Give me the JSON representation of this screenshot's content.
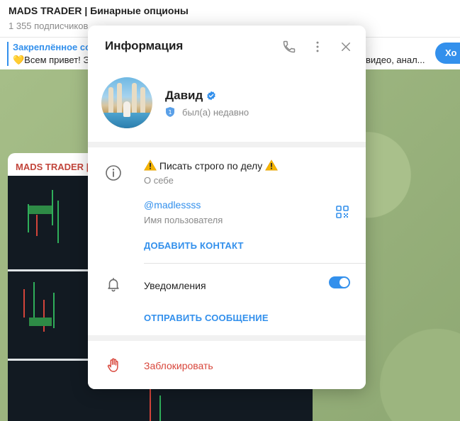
{
  "background": {
    "channel_title": "MADS TRADER | Бинарные опционы",
    "subscribers": "1 355 подписчиков",
    "pinned_title": "Закреплённое со",
    "pinned_text": "💛Всем привет! Э",
    "pinned_text_right": "видео, анал...",
    "pinned_button": "Хо",
    "message_author": "MADS TRADER |"
  },
  "modal": {
    "title": "Информация",
    "icons": {
      "call": "phone-icon",
      "more": "more-vertical-icon",
      "close": "close-icon"
    },
    "user": {
      "name": "Давид",
      "verified_icon": "verified-badge-icon",
      "status": "был(а) недавно"
    },
    "info": {
      "bio": "Писать строго по делу",
      "bio_label": "О себе",
      "username": "@madlessss",
      "username_label": "Имя пользователя",
      "add_contact": "ДОБАВИТЬ КОНТАКТ",
      "notifications": "Уведомления",
      "notifications_on": true,
      "send_message": "ОТПРАВИТЬ СООБЩЕНИЕ"
    },
    "block": "Заблокировать"
  },
  "colors": {
    "accent": "#3390ec",
    "danger": "#d8463b",
    "verified": "#3390ec"
  }
}
